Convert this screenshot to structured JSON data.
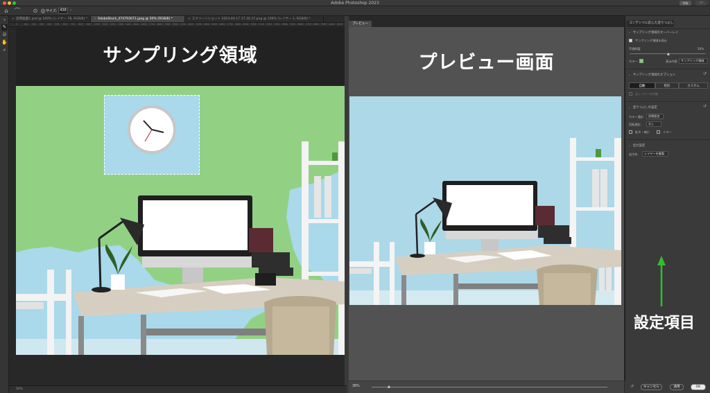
{
  "window": {
    "app_title": "Adobe Photoshop 2023",
    "share_label": "共有",
    "traffic_colors": [
      "#fe5f57",
      "#febc2e",
      "#28c840"
    ]
  },
  "options_bar": {
    "size_label": "サイズ:",
    "size_value": "438"
  },
  "document_tabs": [
    {
      "label": "説明画面1.psd @ 100% (レイヤー 78, RGB/8) *",
      "active": false
    },
    {
      "label": "AdobeStock_474793071.jpeg @ 50% (RGB/8) *",
      "active": true
    },
    {
      "label": "スクリーンショット 2023-04-17 17.30.37.png @ 100% (レイヤー 1, RGB/8) *",
      "active": false
    }
  ],
  "ruler_ticks": [
    "0",
    "100",
    "200",
    "300",
    "400",
    "500",
    "600",
    "700",
    "800",
    "900",
    "1000",
    "1100",
    "1200",
    "1300",
    "1400",
    "1500",
    "1600",
    "1700",
    "1800",
    "1900",
    "2000",
    "2100",
    "2200",
    "2300",
    "2400",
    "2500",
    "2600",
    "2700",
    "2800",
    "2900",
    "3000",
    "3100",
    "3200",
    "3300",
    "3400",
    "3500",
    "3600",
    "3700",
    "3800",
    "3900",
    "4000",
    "4100",
    "4200"
  ],
  "annotations": {
    "left_heading": "サンプリング領域",
    "right_heading": "プレビュー画面",
    "settings_heading": "設定項目",
    "arrow_color": "#2fbf2f"
  },
  "preview": {
    "tab_label": "プレビュー",
    "zoom": "38%"
  },
  "doc_status": {
    "zoom": "50%"
  },
  "panel": {
    "title": "コンテンツに応じた塗りつぶし",
    "overlay_section": "サンプリング領域のオーバーレイ",
    "show_sampling_label": "サンプリング領域を表示",
    "show_sampling_checked": true,
    "opacity_label": "不透明度",
    "opacity_value": "50%",
    "color_label": "カラー",
    "color_value": "#7bd46b",
    "display_label": "表示内容",
    "display_value": "サンプリング領域",
    "options_section": "サンプリング領域のオプション",
    "segments": [
      "自動",
      "矩形",
      "カスタム"
    ],
    "active_segment": 0,
    "all_layers_label": "全レイヤーを対象",
    "fill_section": "塗りつぶしの設定",
    "color_adapt_label": "カラー適応",
    "color_adapt_value": "初期設定",
    "rotate_adapt_label": "回転適応",
    "rotate_adapt_value": "なし",
    "scale_label": "拡大・縮小",
    "mirror_label": "ミラー",
    "output_section": "出力設定",
    "output_label": "出力先",
    "output_value": "レイヤーを複製",
    "cancel_label": "キャンセル",
    "apply_label": "適用",
    "ok_label": "OK"
  }
}
